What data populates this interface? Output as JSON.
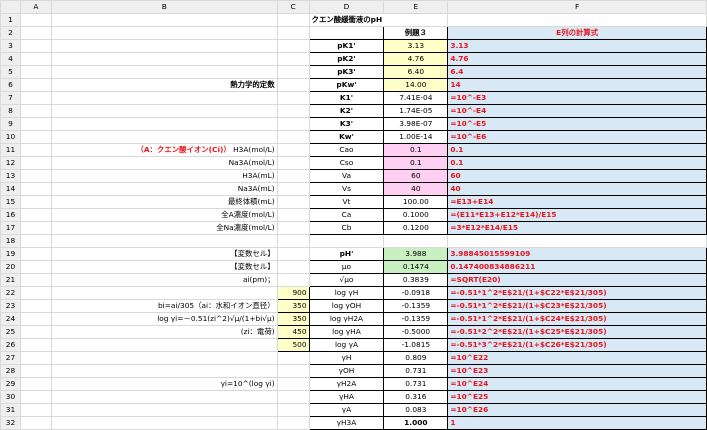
{
  "columns": [
    "A",
    "B",
    "C",
    "D",
    "E",
    "F"
  ],
  "title": "クエン酸緩衝液のpH",
  "rows": [
    {
      "n": "1",
      "b": "",
      "c": "",
      "d": "",
      "e": "",
      "f": "",
      "t": 1
    },
    {
      "n": "2",
      "b": "",
      "c": "",
      "d": "",
      "e": "例題３",
      "f": "E列の計算式",
      "hdr": 1
    },
    {
      "n": "3",
      "b": "",
      "c": "",
      "d": "pK1'",
      "e": "3.13",
      "f": "3.13",
      "es": "yl",
      "db": 1
    },
    {
      "n": "4",
      "b": "",
      "c": "",
      "d": "pK2'",
      "e": "4.76",
      "f": "4.76",
      "es": "yl",
      "db": 1
    },
    {
      "n": "5",
      "b": "",
      "c": "",
      "d": "pK3'",
      "e": "6.40",
      "f": "6.4",
      "es": "yl",
      "db": 1
    },
    {
      "n": "6",
      "b": "熱力学的定数",
      "c": "",
      "d": "pKw'",
      "e": "14.00",
      "f": "14",
      "es": "yl",
      "db": 1,
      "bb": 1
    },
    {
      "n": "7",
      "b": "",
      "c": "",
      "d": "K1'",
      "e": "7.41E-04",
      "f": "=10^-E3",
      "db": 1
    },
    {
      "n": "8",
      "b": "",
      "c": "",
      "d": "K2'",
      "e": "1.74E-05",
      "f": "=10^-E4",
      "db": 1
    },
    {
      "n": "9",
      "b": "",
      "c": "",
      "d": "K3'",
      "e": "3.98E-07",
      "f": "=10^-E5",
      "db": 1
    },
    {
      "n": "10",
      "b": "",
      "c": "",
      "d": "Kw'",
      "e": "1.00E-14",
      "f": "=10^-E6",
      "db": 1
    },
    {
      "n": "11",
      "b": "（A：クエン酸イオン(Ci)） H3A(mol/L)",
      "c": "",
      "d": "Cao",
      "e": "0.1",
      "f": "0.1",
      "es": "pk",
      "bred": 1
    },
    {
      "n": "12",
      "b": "Na3A(mol/L)",
      "c": "",
      "d": "Cso",
      "e": "0.1",
      "f": "0.1",
      "es": "pk"
    },
    {
      "n": "13",
      "b": "H3A(mL)",
      "c": "",
      "d": "Va",
      "e": "60",
      "f": "60",
      "es": "pk"
    },
    {
      "n": "14",
      "b": "Na3A(mL)",
      "c": "",
      "d": "Vs",
      "e": "40",
      "f": "40",
      "es": "pk"
    },
    {
      "n": "15",
      "b": "最終体積(mL)",
      "c": "",
      "d": "Vt",
      "e": "100.00",
      "f": "=E13+E14"
    },
    {
      "n": "16",
      "b": "全A濃度(mol/L)",
      "c": "",
      "d": "Ca",
      "e": "0.1000",
      "f": "=(E11*E13+E12*E14)/E15"
    },
    {
      "n": "17",
      "b": "全Na濃度(mol/L)",
      "c": "",
      "d": "Cb",
      "e": "0.1200",
      "f": "=3*E12*E14/E15"
    },
    {
      "n": "18",
      "b": "",
      "c": "",
      "d": "",
      "e": "",
      "f": "",
      "empty": 1
    },
    {
      "n": "19",
      "b": "【変数セル】",
      "c": "",
      "d": "pH'",
      "e": "3.988",
      "f": "3.98845015599109",
      "es": "gr",
      "db": 1
    },
    {
      "n": "20",
      "b": "【変数セル】",
      "c": "",
      "d": "μo",
      "e": "0.1474",
      "f": "0.147400834886211",
      "es": "gr"
    },
    {
      "n": "21",
      "b": "ai(pm)；",
      "c": "",
      "d": "√μo",
      "e": "0.3839",
      "f": "=SQRT(E20)"
    },
    {
      "n": "22",
      "b": "",
      "c": "900",
      "d": "log γH",
      "e": "-0.0918",
      "f": "=-0.51*1^2*E$21/(1+$C22*E$21/305)",
      "cs": "yl"
    },
    {
      "n": "23",
      "b": "bi=ai/305（ai：水和イオン直径）",
      "c": "350",
      "d": "log γOH",
      "e": "-0.1359",
      "f": "=-0.51*1^2*E$21/(1+$C23*E$21/305)",
      "cs": "yl"
    },
    {
      "n": "24",
      "b": "log γi=－0.51(zi^2)√μ/(1+bi√μ)",
      "c": "350",
      "d": "log γH2A",
      "e": "-0.1359",
      "f": "=-0.51*1^2*E$21/(1+$C24*E$21/305)",
      "cs": "yl"
    },
    {
      "n": "25",
      "b": "(zi：電荷)",
      "c": "450",
      "d": "log γHA",
      "e": "-0.5000",
      "f": "=-0.51*2^2*E$21/(1+$C25*E$21/305)",
      "cs": "yl"
    },
    {
      "n": "26",
      "b": "",
      "c": "500",
      "d": "log γA",
      "e": "-1.0815",
      "f": "=-0.51*3^2*E$21/(1+$C26*E$21/305)",
      "cs": "yl"
    },
    {
      "n": "27",
      "b": "",
      "c": "",
      "d": "γH",
      "e": "0.809",
      "f": "=10^E22"
    },
    {
      "n": "28",
      "b": "",
      "c": "",
      "d": "γOH",
      "e": "0.731",
      "f": "=10^E23"
    },
    {
      "n": "29",
      "b": "γi=10^(log γi)",
      "c": "",
      "d": "γH2A",
      "e": "0.731",
      "f": "=10^E24"
    },
    {
      "n": "30",
      "b": "",
      "c": "",
      "d": "γHA",
      "e": "0.316",
      "f": "=10^E25"
    },
    {
      "n": "31",
      "b": "",
      "c": "",
      "d": "γA",
      "e": "0.083",
      "f": "=10^E26"
    },
    {
      "n": "32",
      "b": "",
      "c": "",
      "d": "γH3A",
      "e": "1.000",
      "f": "1",
      "eb": 1
    }
  ],
  "colors": {
    "yellow": "#ffffc8",
    "pink": "#ffd0f4",
    "green": "#c9f0c0",
    "blue": "#d9e8f5",
    "red": "#e8141b"
  }
}
